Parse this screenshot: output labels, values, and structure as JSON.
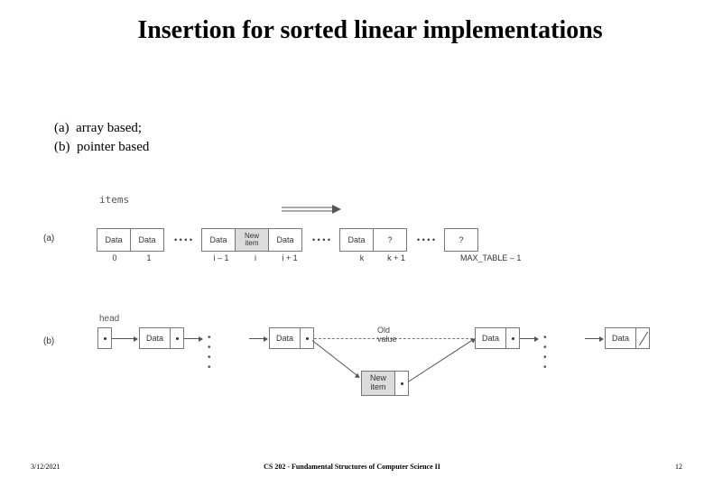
{
  "title": "Insertion for sorted linear implementations",
  "list": {
    "a": "(a)  array based;",
    "b": "(b)  pointer based"
  },
  "figure": {
    "items_label": "items",
    "part_a_label": "(a)",
    "part_b_label": "(b)",
    "head_label": "head",
    "old_value": "Old value",
    "array_cells": [
      "Data",
      "Data",
      "• • • •",
      "Data",
      "New\nitem",
      "Data",
      "• • • •",
      "Data",
      "?",
      "• • • •",
      "?"
    ],
    "indices": [
      "0",
      "1",
      "",
      "i – 1",
      "i",
      "i + 1",
      "",
      "k",
      "k + 1",
      "",
      "MAX_TABLE – 1"
    ],
    "ll_data": "Data",
    "new_item": "New\nitem"
  },
  "footer": {
    "date": "3/12/2021",
    "course": "CS 202 - Fundamental Structures of Computer Science II",
    "page": "12"
  }
}
